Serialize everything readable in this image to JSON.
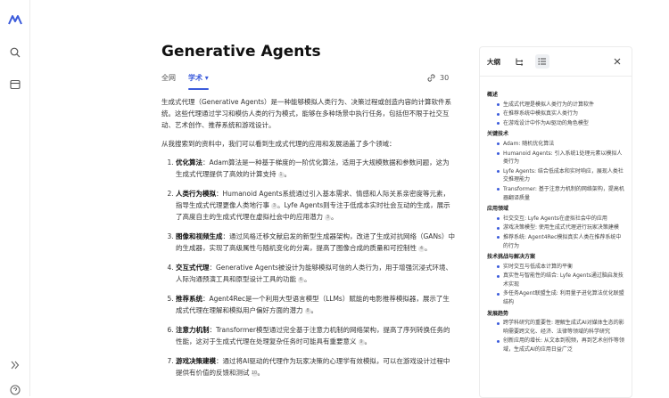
{
  "rail": {
    "icons": [
      "logo-icon",
      "search-icon",
      "library-icon",
      "expand-icon",
      "help-icon"
    ]
  },
  "page": {
    "title": "Generative Agents",
    "tabs": [
      {
        "label": "全网"
      },
      {
        "label": "学术 ▾"
      }
    ],
    "sources_count": "30"
  },
  "content": {
    "intro": "生成式代理（Generative Agents）是一种能够模拟人类行为、决策过程或创造内容的计算软件系统。这些代理通过学习和模仿人类的行为模式，能够在多种场景中执行任务，包括但不限于社交互动、艺术创作、推荐系统和游戏设计。",
    "lead": "从我搜索到的资料中，我们可以看到生成式代理的应用和发展涵盖了多个领域：",
    "items": [
      {
        "title": "优化算法",
        "text": "：Adam算法是一种基于梯度的一阶优化算法，适用于大规模数据和参数问题，这为生成式代理提供了高效的计算支持",
        "cite": "1"
      },
      {
        "title": "人类行为模拟",
        "text": "：Humanoid Agents系统通过引入基本需求、情感和人际关系亲密度等元素，指导生成式代理更像人类地行事",
        "cite": "3",
        "extra": "。Lyfe Agents则专注于低成本实时社会互动的生成，展示了高度自主的生成式代理在虚拟社会中的应用潜力",
        "cite2": "3"
      },
      {
        "title": "图像和视频生成",
        "text": "：通过风格迁移文献启发的新型生成器架构，改进了生成对抗网络（GANs）中的生成器，实现了高级属性与随机变化的分离，提高了图像合成的质量和可控制性",
        "cite": "4"
      },
      {
        "title": "交互式代理",
        "text": "：Generative Agents被设计为能够模拟可信的人类行为，用于增强沉浸式环境、人际沟通预演工具和原型设计工具的功能",
        "cite": "6"
      },
      {
        "title": "推荐系统",
        "text": "：Agent4Rec是一个利用大型语言模型（LLMs）赋能的电影推荐模拟器，展示了生成式代理在理解和模拟用户偏好方面的潜力",
        "cite": "8"
      },
      {
        "title": "注意力机制",
        "text": "：Transformer模型通过完全基于注意力机制的网络架构，提高了序列转换任务的性能，这对于生成式代理在处理复杂任务时可能具有重要意义",
        "cite": "9"
      },
      {
        "title": "游戏决策建模",
        "text": "：通过将AI驱动的代理作为玩家决策的心理学有效模拟，可以在游戏设计过程中提供有价值的反馈和测试",
        "cite": "10"
      }
    ]
  },
  "panel": {
    "title": "大纲",
    "sections": [
      {
        "heading": "概述",
        "items": [
          "生成式代理是模拟人类行为的计算软件",
          "在推荐系统中模拟真实人类行为",
          "在游戏设计中作为AI驱动的角色模型"
        ]
      },
      {
        "heading": "关键技术",
        "items": [
          "Adam: 随机优化算法",
          "Humanoid Agents: 引入系统1处理元素以模拟人类行为",
          "Lyfe Agents: 结合低成本和实时响应，展现人类社交推理能力",
          "Transformer: 基于注意力机制的网络架构，提高机器翻译质量"
        ]
      },
      {
        "heading": "应用领域",
        "items": [
          "社交交互: Lyfe Agents在虚拟社会中的应用",
          "游戏决策模型: 使用生成式代理进行玩家决策建模",
          "推荐系统: Agent4Rec模拟真实人类在推荐系统中的行为"
        ]
      },
      {
        "heading": "技术挑战与解决方案",
        "items": [
          "实时交互与低成本计算的平衡",
          "真实性与智能性的结合: Lyfe Agents通过脑启发技术实现",
          "多任务Agent联盟生成: 利用量子进化算法优化联盟结构"
        ]
      },
      {
        "heading": "发展趋势",
        "items": [
          "跨学科研究的重要性: 理解生成式AI对媒体生态的影响需要跨文化、经济、法律等领域的科学研究",
          "创新应用的增长: 从文本到视频，再到艺术创作等领域，生成式AI的应用日益广泛"
        ]
      }
    ]
  }
}
